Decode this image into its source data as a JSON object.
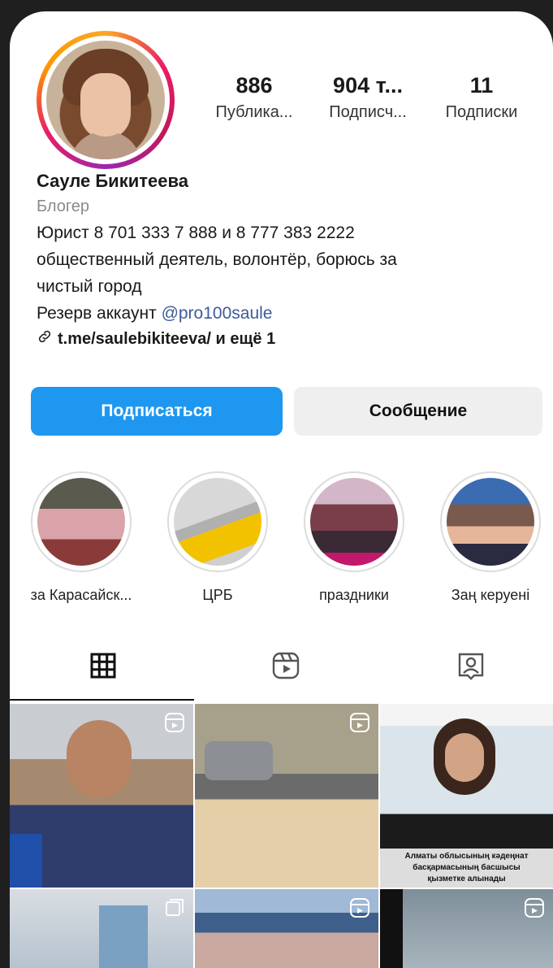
{
  "profile": {
    "name": "Сауле Бикитеева",
    "category": "Блогер",
    "bio_line1": "Юрист 8 701 333 7 888 и 8 777 383 2222",
    "bio_line2": "общественный деятель, волонтёр, борюсь за",
    "bio_line3": "чистый город",
    "reserve_prefix": "Резерв аккаунт ",
    "reserve_handle": "@pro100saule",
    "link": "t.me/saulebikiteeva/ и ещё 1"
  },
  "stats": [
    {
      "value": "886",
      "label": "Публика..."
    },
    {
      "value": "904 т...",
      "label": "Подписч..."
    },
    {
      "value": "11",
      "label": "Подписки"
    }
  ],
  "actions": {
    "follow": "Подписаться",
    "message": "Сообщение"
  },
  "highlights": [
    {
      "label": "за Карасайск..."
    },
    {
      "label": "ЦРБ"
    },
    {
      "label": "праздники"
    },
    {
      "label": "Заң керуені"
    }
  ],
  "tabs": [
    {
      "icon": "grid-icon",
      "active": true
    },
    {
      "icon": "reels-icon",
      "active": false
    },
    {
      "icon": "tagged-icon",
      "active": false
    }
  ],
  "posts": [
    {
      "type": "reel"
    },
    {
      "type": "reel"
    },
    {
      "type": "image",
      "caption_line1": "Алматы облысының кәдеңнат",
      "caption_line2": "басқармасының басшысы",
      "caption_line3": "қызметке алынады"
    },
    {
      "type": "carousel"
    },
    {
      "type": "reel"
    },
    {
      "type": "reel"
    }
  ],
  "colors": {
    "accent": "#1e97f0",
    "background": "#1f1f1f"
  }
}
